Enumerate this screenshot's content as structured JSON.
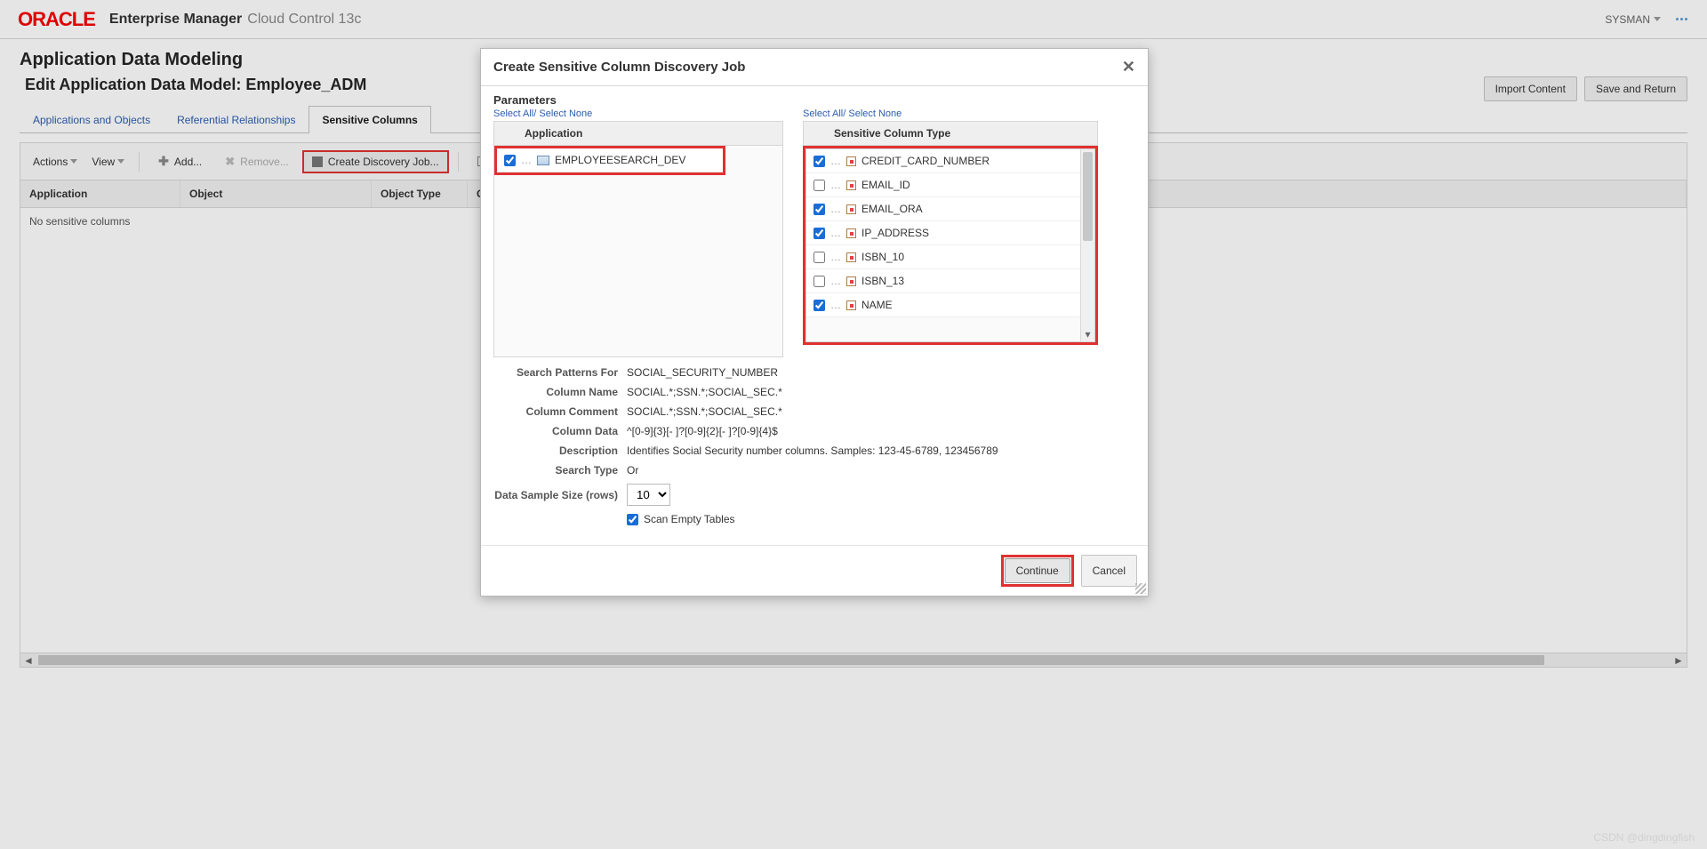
{
  "header": {
    "logo": "ORACLE",
    "em": "Enterprise Manager",
    "cc": "Cloud Control 13c",
    "user": "SYSMAN"
  },
  "page": {
    "title": "Application Data Modeling",
    "subtitle": "Edit Application Data Model: Employee_ADM",
    "import_btn": "Import Content",
    "save_btn": "Save and Return"
  },
  "tabs": {
    "t1": "Applications and Objects",
    "t2": "Referential Relationships",
    "t3": "Sensitive Columns"
  },
  "toolbar": {
    "actions": "Actions",
    "view": "View",
    "add": "Add...",
    "remove": "Remove...",
    "discover": "Create Discovery Job..."
  },
  "table": {
    "h1": "Application",
    "h2": "Object",
    "h3": "Object Type",
    "h4": "C",
    "empty": "No sensitive columns"
  },
  "dialog": {
    "title": "Create Sensitive Column Discovery Job",
    "close": "✕",
    "parameters": "Parameters",
    "select_all": "Select All/ Select None",
    "app_header": "Application",
    "app_item": "EMPLOYEESEARCH_DEV",
    "sct_header": "Sensitive Column Type",
    "sct": {
      "i0": "CREDIT_CARD_NUMBER",
      "i1": "EMAIL_ID",
      "i2": "EMAIL_ORA",
      "i3": "IP_ADDRESS",
      "i4": "ISBN_10",
      "i5": "ISBN_13",
      "i6": "NAME"
    },
    "form": {
      "search_for_l": "Search Patterns For",
      "search_for_v": "SOCIAL_SECURITY_NUMBER",
      "col_name_l": "Column Name",
      "col_name_v": "SOCIAL.*;SSN.*;SOCIAL_SEC.*",
      "col_comment_l": "Column Comment",
      "col_comment_v": "SOCIAL.*;SSN.*;SOCIAL_SEC.*",
      "col_data_l": "Column Data",
      "col_data_v": "^[0-9]{3}[- ]?[0-9]{2}[- ]?[0-9]{4}$",
      "desc_l": "Description",
      "desc_v": "Identifies Social Security number columns. Samples: 123-45-6789, 123456789",
      "stype_l": "Search Type",
      "stype_v": "Or",
      "sample_l": "Data Sample Size (rows)",
      "sample_v": "10",
      "scan_empty": "Scan Empty Tables"
    },
    "continue": "Continue",
    "cancel": "Cancel"
  },
  "watermark": "CSDN @dingdingfish"
}
